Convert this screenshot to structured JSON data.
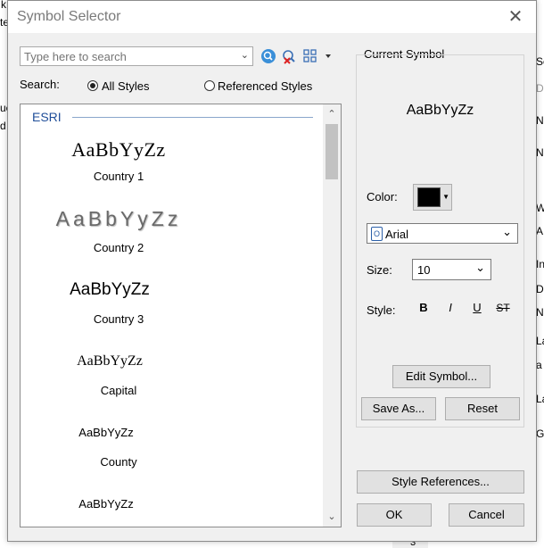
{
  "dialog": {
    "title": "Symbol Selector",
    "search": {
      "placeholder": "Type here to search"
    },
    "search_label": "Search:",
    "radio_all": "All Styles",
    "radio_referenced": "Referenced Styles",
    "group_label": "ESRI",
    "symbols": [
      {
        "sample": "AaBbYyZz",
        "name": "Country 1"
      },
      {
        "sample": "AaBbYyZz",
        "name": "Country 2"
      },
      {
        "sample": "AaBbYyZz",
        "name": "Country 3"
      },
      {
        "sample": "AaBbYyZz",
        "name": "Capital"
      },
      {
        "sample": "AaBbYyZz",
        "name": "County"
      },
      {
        "sample": "AaBbYyZz",
        "name": ""
      }
    ],
    "current_symbol": {
      "heading": "Current Symbol",
      "preview": "AaBbYyZz",
      "color_label": "Color:",
      "color_value": "#000000",
      "font_value": "Arial",
      "size_label": "Size:",
      "size_value": "10",
      "style_label": "Style:",
      "style_buttons": [
        "B",
        "I",
        "U",
        "ST"
      ]
    },
    "buttons": {
      "edit_symbol": "Edit Symbol...",
      "save_as": "Save As...",
      "reset": "Reset",
      "style_references": "Style References...",
      "ok": "OK",
      "cancel": "Cancel"
    }
  },
  "behind": {
    "top_fragments": [
      "k",
      "te"
    ],
    "left_fragments": [
      "uc",
      "d"
    ],
    "right_fragments": [
      "Sc",
      "Di",
      "Nu",
      "Nu",
      "W",
      "A",
      "In",
      "Di",
      "N",
      "La",
      "a",
      "La",
      "Ga"
    ],
    "bottom_fragment": "3"
  }
}
